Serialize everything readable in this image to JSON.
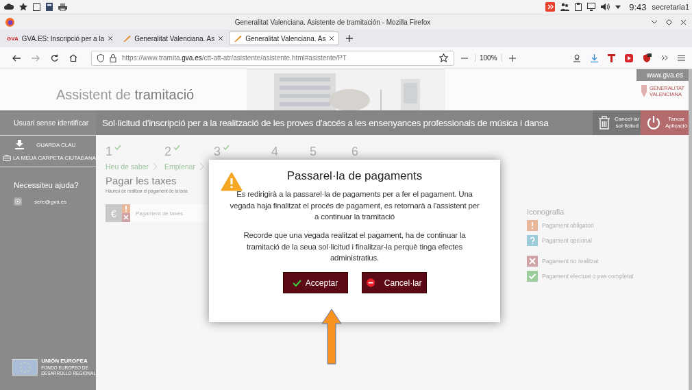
{
  "system_bar": {
    "clock": "9:43",
    "user": "secretaria1"
  },
  "window": {
    "title": "Generalitat Valenciana. Asistente de tramitación - Mozilla Firefox"
  },
  "tabs": [
    {
      "label": "GVA.ES: Inscripció per a la",
      "favicon": "GVA",
      "selected": false
    },
    {
      "label": "Generalitat Valenciana. As",
      "selected": false
    },
    {
      "label": "Generalitat Valenciana. As",
      "selected": true
    }
  ],
  "address_bar": {
    "url": "https://www.tramita.**gva.es**/ctt-att-atr/asistente/asistente.html#asistente/PT",
    "zoom": "100%"
  },
  "header": {
    "title": "Assistent de **tramitació**",
    "site_link": "www.gva.es",
    "logo_lines": [
      "GENERALITAT",
      "VALENCIANA"
    ]
  },
  "sidebar": {
    "user": "Usuari sense identificar",
    "items": [
      "GUARDA CLAU",
      "LA MEUA CARPETA CIUTADANA"
    ],
    "help_title": "Necessiteu ajuda?",
    "email": "sere@gva.es",
    "eu_lines": [
      "UNIÓN EUROPEA",
      "FONDO EUROPEO DE",
      "DESARROLLO REGIONAL"
    ]
  },
  "title_bar": {
    "title": "Sol·licitud d'inscripció per a la realització de les proves d'accés a les ensenyances professionals de música i dansa",
    "actions": [
      {
        "kind": "cancel",
        "lines": [
          "Cancel·lar",
          "sol·licitud"
        ]
      },
      {
        "kind": "close",
        "lines": [
          "Tancar",
          "Aplicació"
        ]
      }
    ]
  },
  "steps": [
    {
      "number": "1",
      "completed": true,
      "label": "Heu de saber"
    },
    {
      "number": "2",
      "completed": true,
      "label": "Emplenar"
    },
    {
      "number": "3",
      "completed": true
    },
    {
      "number": "4",
      "completed": false
    },
    {
      "number": "5",
      "completed": false
    },
    {
      "number": "6",
      "completed": false
    }
  ],
  "section": {
    "title": "Pagar les taxes",
    "description": "Haureu de realitzar el pagament de la taxa"
  },
  "payments": [
    {
      "currency": "€",
      "label": "Pagament de taxes",
      "kind": "required_not_done"
    }
  ],
  "legend": {
    "title": "Iconografia",
    "items": [
      {
        "kind": "required",
        "label": "Pagament obligatori"
      },
      {
        "kind": "optional",
        "label": "Pagament opcional"
      },
      {
        "kind": "not_done",
        "label": "Pagament no realitzat"
      },
      {
        "kind": "done",
        "label": "Pagament efectuat o pas completat"
      }
    ]
  },
  "dialog": {
    "title": "Passarel·la de pagaments",
    "paragraphs": [
      "Es redirigirà a la passarel·la de pagaments per a fer el pagament. Una vegada haja finalitzat el procés de pagament, es retornarà a l'assistent per a continuar la tramitació",
      "Recorde que una vegada realitzat el pagament, ha de continuar la tramitació de la seua sol·licitud i finalitzar-la perquè tinga efectes administratius."
    ],
    "buttons": [
      {
        "kind": "accept",
        "label": "Acceptar"
      },
      {
        "kind": "cancel",
        "label": "Cancel·lar"
      }
    ]
  }
}
